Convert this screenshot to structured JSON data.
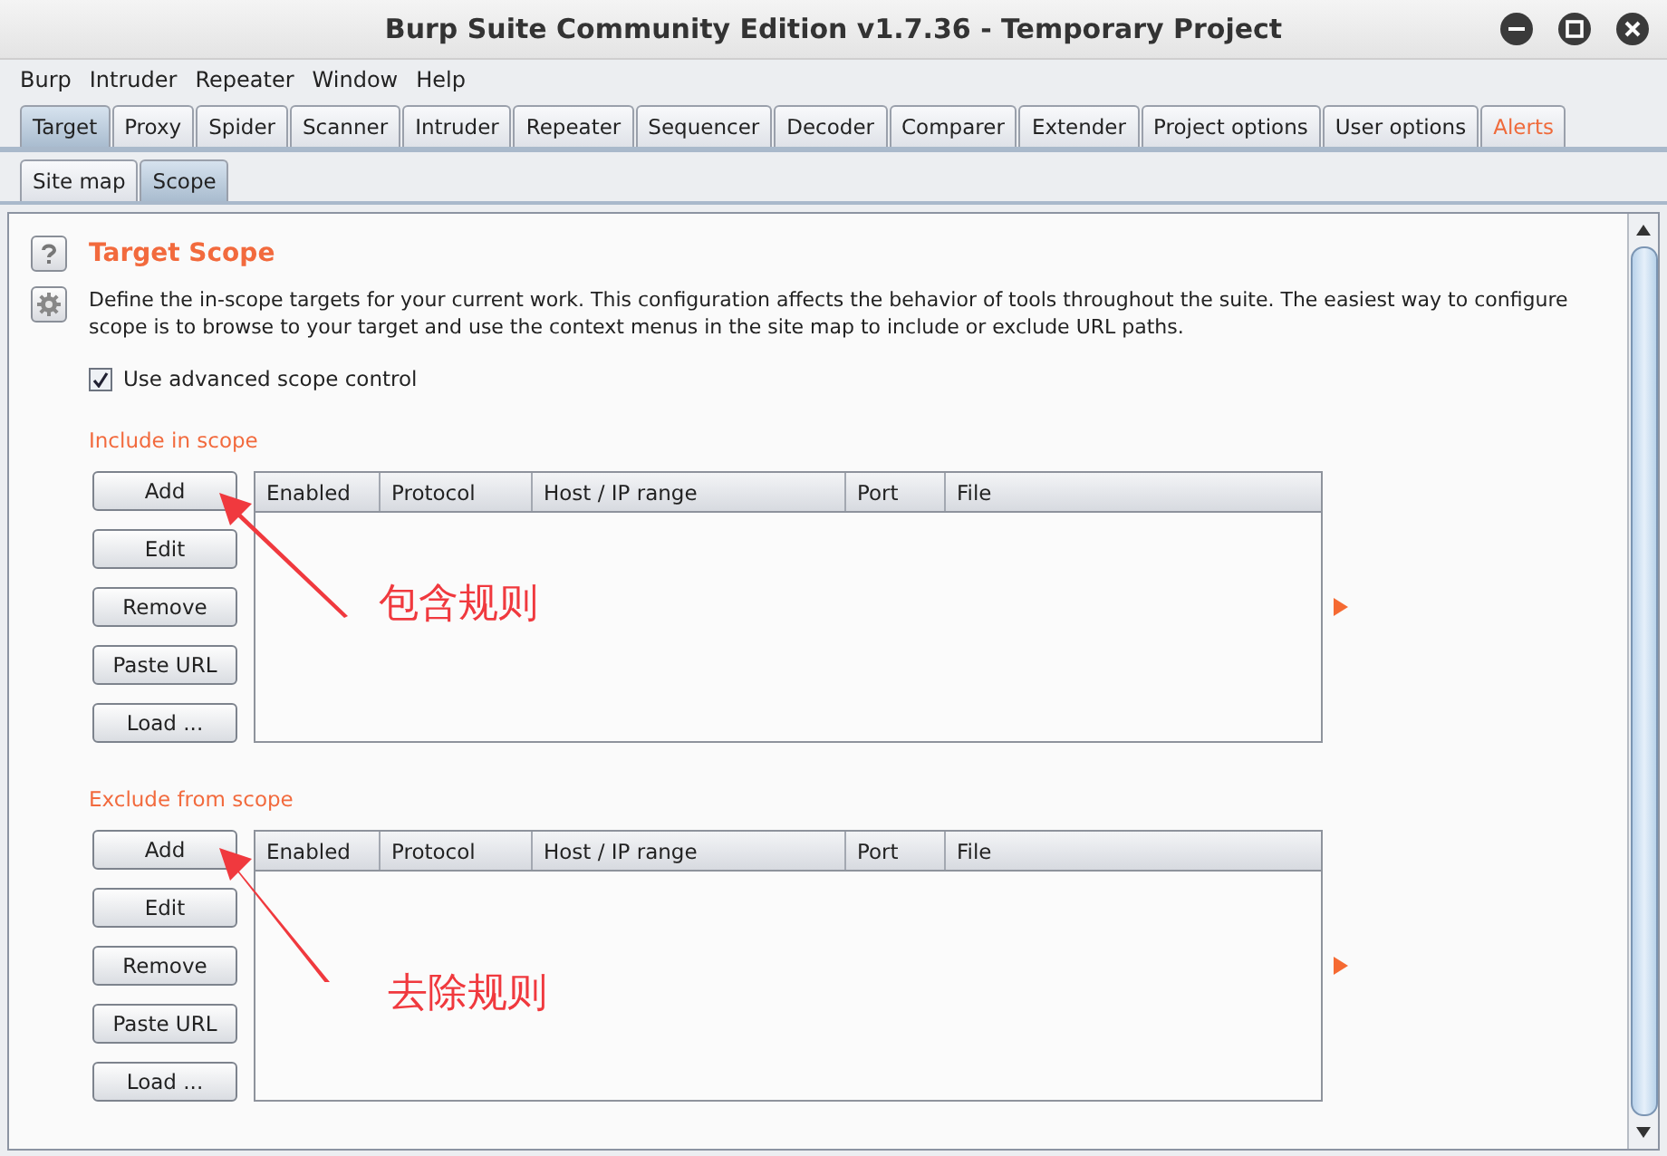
{
  "window": {
    "title": "Burp Suite Community Edition v1.7.36 - Temporary Project"
  },
  "menu": [
    "Burp",
    "Intruder",
    "Repeater",
    "Window",
    "Help"
  ],
  "tabs": [
    {
      "label": "Target",
      "selected": true,
      "alert": false
    },
    {
      "label": "Proxy",
      "selected": false,
      "alert": false
    },
    {
      "label": "Spider",
      "selected": false,
      "alert": false
    },
    {
      "label": "Scanner",
      "selected": false,
      "alert": false
    },
    {
      "label": "Intruder",
      "selected": false,
      "alert": false
    },
    {
      "label": "Repeater",
      "selected": false,
      "alert": false
    },
    {
      "label": "Sequencer",
      "selected": false,
      "alert": false
    },
    {
      "label": "Decoder",
      "selected": false,
      "alert": false
    },
    {
      "label": "Comparer",
      "selected": false,
      "alert": false
    },
    {
      "label": "Extender",
      "selected": false,
      "alert": false
    },
    {
      "label": "Project options",
      "selected": false,
      "alert": false
    },
    {
      "label": "User options",
      "selected": false,
      "alert": false
    },
    {
      "label": "Alerts",
      "selected": false,
      "alert": true
    }
  ],
  "subtabs": [
    {
      "label": "Site map",
      "selected": false
    },
    {
      "label": "Scope",
      "selected": true
    }
  ],
  "panel": {
    "title": "Target Scope",
    "description": "Define the in-scope targets for your current work. This configuration affects the behavior of tools throughout the suite. The easiest way to configure scope is to browse to your target and use the context menus in the site map to include or exclude URL paths.",
    "checkbox": {
      "label": "Use advanced scope control",
      "checked": true
    },
    "sections": [
      {
        "title": "Include in scope",
        "buttons": [
          "Add",
          "Edit",
          "Remove",
          "Paste URL",
          "Load ..."
        ],
        "columns": [
          "Enabled",
          "Protocol",
          "Host / IP range",
          "Port",
          "File"
        ],
        "annotation": "包含规则"
      },
      {
        "title": "Exclude from scope",
        "buttons": [
          "Add",
          "Edit",
          "Remove",
          "Paste URL",
          "Load ..."
        ],
        "columns": [
          "Enabled",
          "Protocol",
          "Host / IP range",
          "Port",
          "File"
        ],
        "annotation": "去除规则"
      }
    ]
  }
}
